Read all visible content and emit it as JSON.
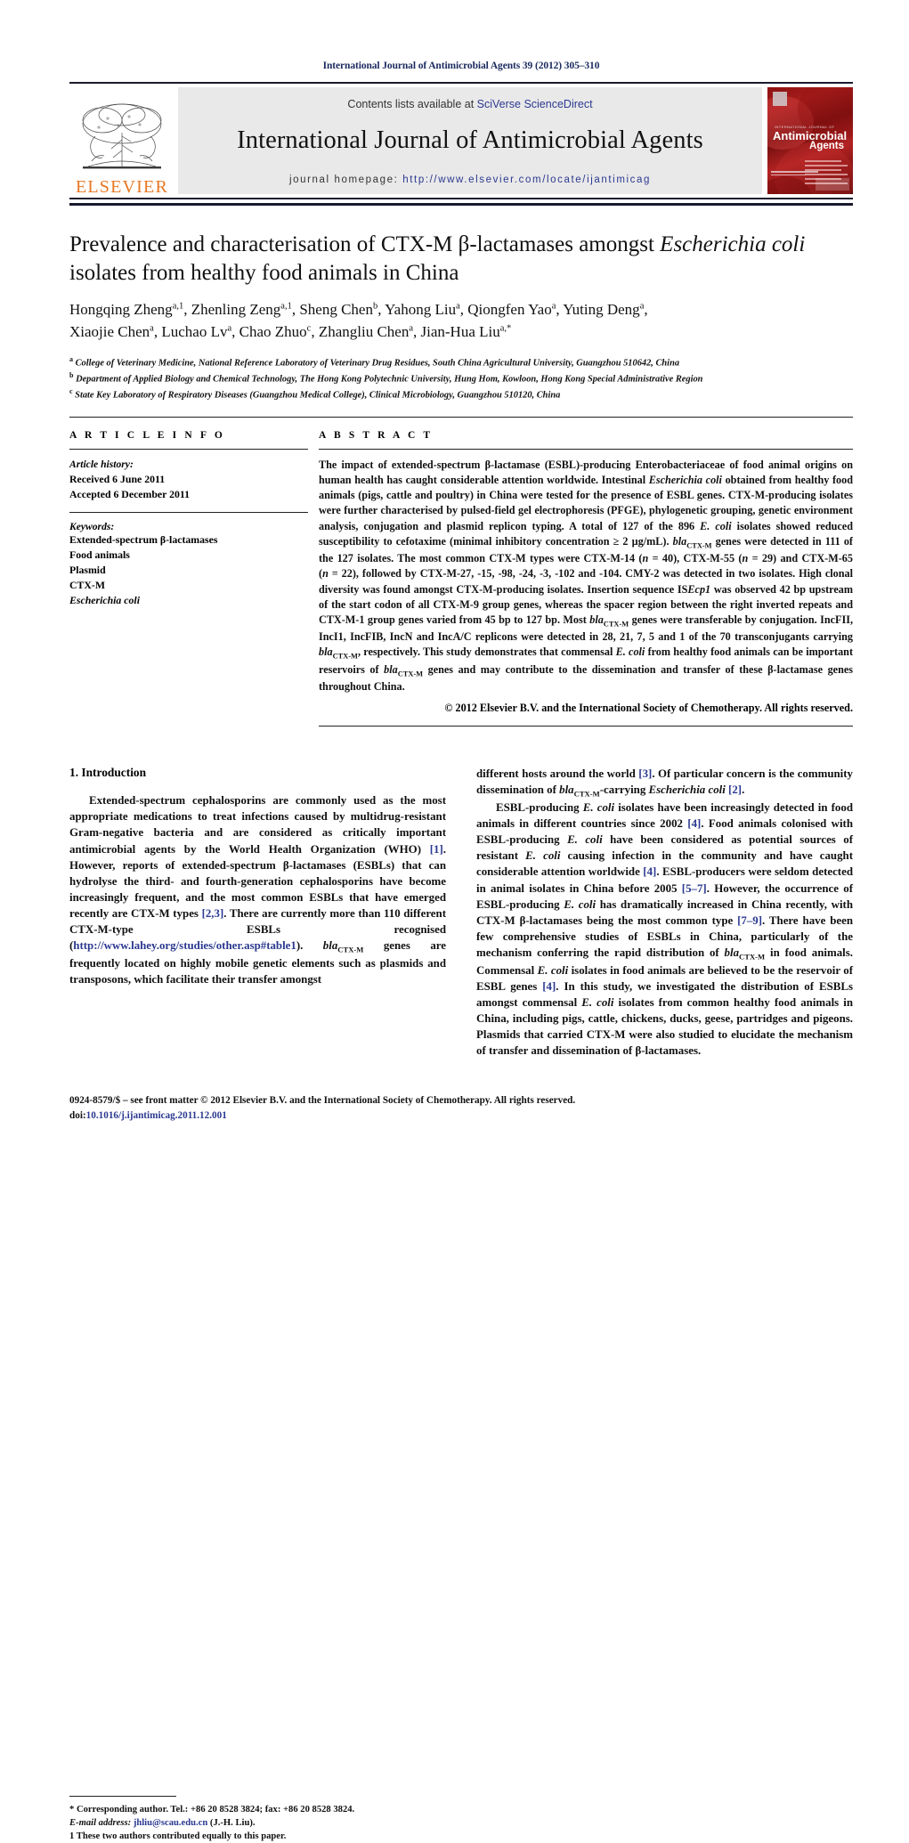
{
  "running_head": "International Journal of Antimicrobial Agents 39 (2012) 305–310",
  "masthead": {
    "publisher_logo_text": "ELSEVIER",
    "contents_prefix": "Contents lists available at ",
    "contents_link": "SciVerse ScienceDirect",
    "journal_title": "International Journal of Antimicrobial Agents",
    "homepage_label": "journal homepage: ",
    "homepage_url": "http://www.elsevier.com/locate/ijantimicag",
    "cover": {
      "supertitle": "INTERNATIONAL JOURNAL OF",
      "line1": "Antimicrobial",
      "line2": "Agents",
      "brand_color": "#8d1111"
    }
  },
  "title": {
    "part1": "Prevalence and characterisation of CTX-M β-lactamases amongst ",
    "italic1": "Escherichia coli",
    "part2": " isolates from healthy food animals in China"
  },
  "authors_line1": "Hongqing Zheng",
  "authors": [
    {
      "name": "Hongqing Zheng",
      "sup": "a,1"
    },
    {
      "name": "Zhenling Zeng",
      "sup": "a,1"
    },
    {
      "name": "Sheng Chen",
      "sup": "b"
    },
    {
      "name": "Yahong Liu",
      "sup": "a"
    },
    {
      "name": "Qiongfen Yao",
      "sup": "a"
    },
    {
      "name": "Yuting Deng",
      "sup": "a"
    },
    {
      "name": "Xiaojie Chen",
      "sup": "a"
    },
    {
      "name": "Luchao Lv",
      "sup": "a"
    },
    {
      "name": "Chao Zhuo",
      "sup": "c"
    },
    {
      "name": "Zhangliu Chen",
      "sup": "a"
    },
    {
      "name": "Jian-Hua Liu",
      "sup": "a,*"
    }
  ],
  "affiliations": [
    {
      "mark": "a",
      "text": "College of Veterinary Medicine, National Reference Laboratory of Veterinary Drug Residues, South China Agricultural University, Guangzhou 510642, China"
    },
    {
      "mark": "b",
      "text": "Department of Applied Biology and Chemical Technology, The Hong Kong Polytechnic University, Hung Hom, Kowloon, Hong Kong Special Administrative Region"
    },
    {
      "mark": "c",
      "text": "State Key Laboratory of Respiratory Diseases (Guangzhou Medical College), Clinical Microbiology, Guangzhou 510120, China"
    }
  ],
  "article_info": {
    "heading": "A R T I C L E    I N F O",
    "history_label": "Article history:",
    "received": "Received 6 June 2011",
    "accepted": "Accepted 6 December 2011",
    "keywords_label": "Keywords:",
    "keywords": [
      {
        "text": "Extended-spectrum β-lactamases",
        "italic": false
      },
      {
        "text": "Food animals",
        "italic": false
      },
      {
        "text": "Plasmid",
        "italic": false
      },
      {
        "text": "CTX-M",
        "italic": false
      },
      {
        "text": "Escherichia coli",
        "italic": true
      }
    ]
  },
  "abstract": {
    "heading": "A B S T R A C T",
    "copyright": "© 2012 Elsevier B.V. and the International Society of Chemotherapy. All rights reserved."
  },
  "introduction": {
    "number_title": "1.  Introduction"
  },
  "footnotes": {
    "corresponding": "*  Corresponding author. Tel.: +86 20 8528 3824; fax: +86 20 8528 3824.",
    "email_label": "E-mail address:",
    "email": "jhliu@scau.edu.cn",
    "email_suffix": " (J.-H. Liu).",
    "equal_contrib": "1  These two authors contributed equally to this paper."
  },
  "bottom": {
    "issn_line": "0924-8579/$ – see front matter © 2012 Elsevier B.V. and the International Society of Chemotherapy. All rights reserved.",
    "doi_label": "doi:",
    "doi": "10.1016/j.ijantimicag.2011.12.001"
  }
}
